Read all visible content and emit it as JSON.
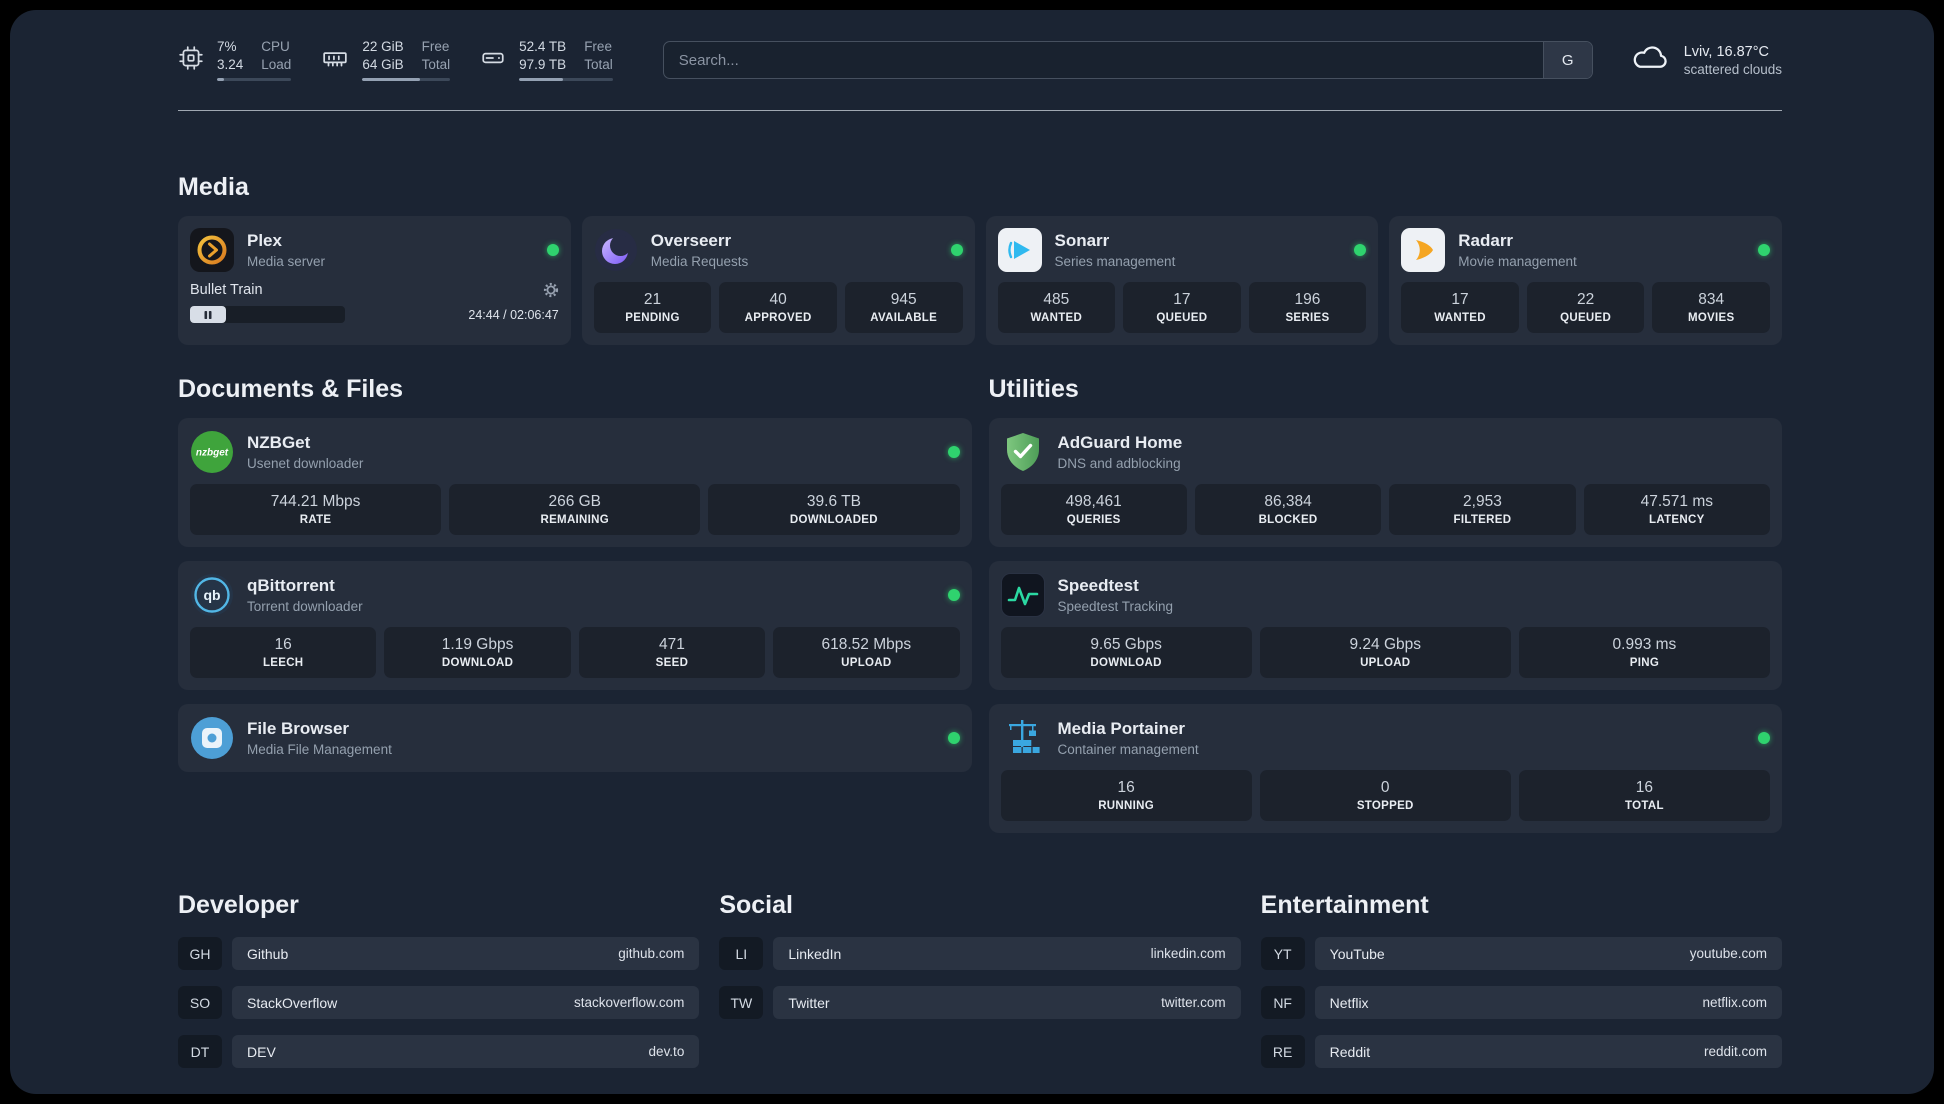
{
  "colors": {
    "status_online": "#2fd36e",
    "plex_gold": "#e5a00d",
    "overseerr_purple": "#8b6ef4",
    "sonarr_blue": "#2fb9ef",
    "radarr_orange": "#f5a623",
    "nzbget_green": "#3fa43c",
    "qbittorrent_blue": "#52b7e6",
    "filebrowser_blue": "#4d9fd6",
    "adguard_green": "#66b574",
    "speedtest_green": "#2bd9a2",
    "portainer_blue": "#3aa7e0"
  },
  "topbar": {
    "cpu": {
      "percent": "7%",
      "load": "3.24",
      "label_top": "CPU",
      "label_bottom": "Load"
    },
    "memory": {
      "free": "22 GiB",
      "total": "64 GiB",
      "label_top": "Free",
      "label_bottom": "Total"
    },
    "disk": {
      "free": "52.4 TB",
      "total": "97.9 TB",
      "label_top": "Free",
      "label_bottom": "Total"
    },
    "search": {
      "placeholder": "Search...",
      "button_label": "G"
    },
    "weather": {
      "location": "Lviv, 16.87°C",
      "condition": "scattered clouds"
    }
  },
  "media": {
    "title": "Media",
    "cards": [
      {
        "name": "Plex",
        "subtitle": "Media server",
        "player": {
          "title": "Bullet Train",
          "time": "24:44 / 02:06:47"
        }
      },
      {
        "name": "Overseerr",
        "subtitle": "Media Requests",
        "stats": [
          {
            "value": "21",
            "label": "PENDING"
          },
          {
            "value": "40",
            "label": "APPROVED"
          },
          {
            "value": "945",
            "label": "AVAILABLE"
          }
        ]
      },
      {
        "name": "Sonarr",
        "subtitle": "Series management",
        "stats": [
          {
            "value": "485",
            "label": "WANTED"
          },
          {
            "value": "17",
            "label": "QUEUED"
          },
          {
            "value": "196",
            "label": "SERIES"
          }
        ]
      },
      {
        "name": "Radarr",
        "subtitle": "Movie management",
        "stats": [
          {
            "value": "17",
            "label": "WANTED"
          },
          {
            "value": "22",
            "label": "QUEUED"
          },
          {
            "value": "834",
            "label": "MOVIES"
          }
        ]
      }
    ]
  },
  "documents": {
    "title": "Documents & Files",
    "cards": [
      {
        "name": "NZBGet",
        "subtitle": "Usenet downloader",
        "stats": [
          {
            "value": "744.21 Mbps",
            "label": "RATE"
          },
          {
            "value": "266 GB",
            "label": "REMAINING"
          },
          {
            "value": "39.6 TB",
            "label": "DOWNLOADED"
          }
        ]
      },
      {
        "name": "qBittorrent",
        "subtitle": "Torrent downloader",
        "stats": [
          {
            "value": "16",
            "label": "LEECH"
          },
          {
            "value": "1.19 Gbps",
            "label": "DOWNLOAD"
          },
          {
            "value": "471",
            "label": "SEED"
          },
          {
            "value": "618.52 Mbps",
            "label": "UPLOAD"
          }
        ]
      },
      {
        "name": "File Browser",
        "subtitle": "Media File Management"
      }
    ]
  },
  "utilities": {
    "title": "Utilities",
    "cards": [
      {
        "name": "AdGuard Home",
        "subtitle": "DNS and adblocking",
        "stats": [
          {
            "value": "498,461",
            "label": "QUERIES"
          },
          {
            "value": "86,384",
            "label": "BLOCKED"
          },
          {
            "value": "2,953",
            "label": "FILTERED"
          },
          {
            "value": "47.571 ms",
            "label": "LATENCY"
          }
        ]
      },
      {
        "name": "Speedtest",
        "subtitle": "Speedtest Tracking",
        "stats": [
          {
            "value": "9.65 Gbps",
            "label": "DOWNLOAD"
          },
          {
            "value": "9.24 Gbps",
            "label": "UPLOAD"
          },
          {
            "value": "0.993 ms",
            "label": "PING"
          }
        ]
      },
      {
        "name": "Media Portainer",
        "subtitle": "Container management",
        "stats": [
          {
            "value": "16",
            "label": "RUNNING"
          },
          {
            "value": "0",
            "label": "STOPPED"
          },
          {
            "value": "16",
            "label": "TOTAL"
          }
        ]
      }
    ]
  },
  "bookmarks": {
    "groups": [
      {
        "title": "Developer",
        "items": [
          {
            "abbr": "GH",
            "name": "Github",
            "url": "github.com"
          },
          {
            "abbr": "SO",
            "name": "StackOverflow",
            "url": "stackoverflow.com"
          },
          {
            "abbr": "DT",
            "name": "DEV",
            "url": "dev.to"
          }
        ]
      },
      {
        "title": "Social",
        "items": [
          {
            "abbr": "LI",
            "name": "LinkedIn",
            "url": "linkedin.com"
          },
          {
            "abbr": "TW",
            "name": "Twitter",
            "url": "twitter.com"
          }
        ]
      },
      {
        "title": "Entertainment",
        "items": [
          {
            "abbr": "YT",
            "name": "YouTube",
            "url": "youtube.com"
          },
          {
            "abbr": "NF",
            "name": "Netflix",
            "url": "netflix.com"
          },
          {
            "abbr": "RE",
            "name": "Reddit",
            "url": "reddit.com"
          }
        ]
      }
    ]
  }
}
